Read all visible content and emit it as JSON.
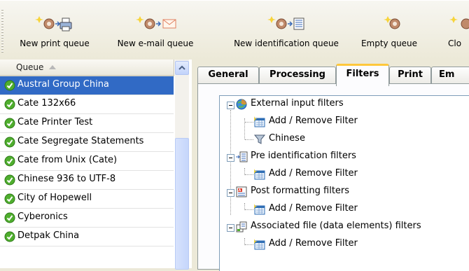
{
  "toolbar": {
    "buttons": [
      {
        "label": "New print queue",
        "icon": "new-print-queue-icon"
      },
      {
        "label": "New e-mail queue",
        "icon": "new-email-queue-icon"
      },
      {
        "label": "New identification queue",
        "icon": "new-identification-queue-icon"
      },
      {
        "label": "Empty queue",
        "icon": "empty-queue-icon"
      },
      {
        "label": "Clo",
        "icon": "clone-queue-icon"
      }
    ]
  },
  "queue_list": {
    "header": "Queue",
    "selected_index": 0,
    "items": [
      "Austral Group China",
      "Cate 132x66",
      "Cate Printer Test",
      "Cate Segregate Statements",
      "Cate from Unix (Cate)",
      "Chinese 936 to UTF-8",
      "City of Hopewell",
      "Cyberonics",
      "Detpak China"
    ]
  },
  "tabs": {
    "items": [
      "General",
      "Processing",
      "Filters",
      "Print",
      "Em"
    ],
    "active": "Filters"
  },
  "filters_tree": {
    "groups": [
      {
        "label": "External input filters",
        "icon": "globe-filter-icon",
        "children": [
          {
            "label": "Add / Remove Filter",
            "icon": "add-remove-filter-icon"
          },
          {
            "label": "Chinese",
            "icon": "funnel-icon"
          }
        ]
      },
      {
        "label": "Pre identification filters",
        "icon": "pre-identification-icon",
        "children": [
          {
            "label": "Add / Remove Filter",
            "icon": "add-remove-filter-icon"
          }
        ]
      },
      {
        "label": "Post formatting filters",
        "icon": "post-formatting-icon",
        "children": [
          {
            "label": "Add / Remove Filter",
            "icon": "add-remove-filter-icon"
          }
        ]
      },
      {
        "label": "Associated file (data elements) filters",
        "icon": "associated-file-icon",
        "children": [
          {
            "label": "Add / Remove Filter",
            "icon": "add-remove-filter-icon"
          }
        ]
      }
    ]
  },
  "colors": {
    "selection": "#316ac5",
    "active_tab_accent": "#ffc83c",
    "check_green": "#4fae2e"
  }
}
